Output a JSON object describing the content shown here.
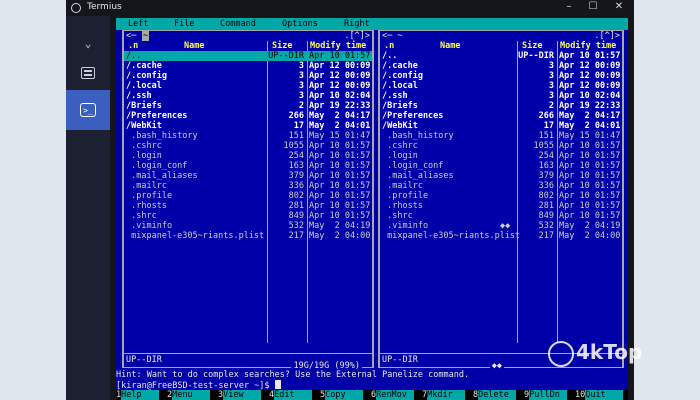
{
  "window": {
    "title": "Termius",
    "controls": [
      "–",
      "☐",
      "✕"
    ]
  },
  "sidebar": {
    "items": [
      {
        "name": "chevron-down-icon",
        "glyph": "⌄"
      },
      {
        "name": "hosts-icon"
      },
      {
        "name": "terminal-icon",
        "glyph": ">_"
      }
    ]
  },
  "menubar": {
    "items": [
      "Left",
      "File",
      "Command",
      "Options",
      "Right"
    ]
  },
  "left_panel": {
    "nav_left": "<─ ",
    "hotkey": "~",
    "nav_right": ".[^]>",
    "headers": {
      "n": ".n",
      "name": "Name",
      "size": "Size",
      "modify": "Modify time"
    },
    "rows": [
      {
        "name": "/..",
        "size": "UP--DIR",
        "date": "Apr 10 01:57",
        "type": "sel"
      },
      {
        "name": "/.cache",
        "size": "3",
        "date": "Apr 12 00:09",
        "type": "dir"
      },
      {
        "name": "/.config",
        "size": "3",
        "date": "Apr 12 00:09",
        "type": "dir"
      },
      {
        "name": "/.local",
        "size": "3",
        "date": "Apr 12 00:09",
        "type": "dir"
      },
      {
        "name": "/.ssh",
        "size": "3",
        "date": "Apr 10 02:04",
        "type": "dir"
      },
      {
        "name": "/Briefs",
        "size": "2",
        "date": "Apr 19 22:33",
        "type": "dir"
      },
      {
        "name": "/Preferences",
        "size": "266",
        "date": "May  2 04:17",
        "type": "dir"
      },
      {
        "name": "/WebKit",
        "size": "17",
        "date": "May  2 04:01",
        "type": "dir"
      },
      {
        "name": " .bash_history",
        "size": "151",
        "date": "May 15 01:47",
        "type": "file"
      },
      {
        "name": " .cshrc",
        "size": "1055",
        "date": "Apr 10 01:57",
        "type": "file"
      },
      {
        "name": " .login",
        "size": "254",
        "date": "Apr 10 01:57",
        "type": "file"
      },
      {
        "name": " .login_conf",
        "size": "163",
        "date": "Apr 10 01:57",
        "type": "file"
      },
      {
        "name": " .mail_aliases",
        "size": "379",
        "date": "Apr 10 01:57",
        "type": "file"
      },
      {
        "name": " .mailrc",
        "size": "336",
        "date": "Apr 10 01:57",
        "type": "file"
      },
      {
        "name": " .profile",
        "size": "802",
        "date": "Apr 10 01:57",
        "type": "file"
      },
      {
        "name": " .rhosts",
        "size": "281",
        "date": "Apr 10 01:57",
        "type": "file"
      },
      {
        "name": " .shrc",
        "size": "849",
        "date": "Apr 10 01:57",
        "type": "file"
      },
      {
        "name": " .viminfo",
        "size": "532",
        "date": "May  2 04:19",
        "type": "file"
      },
      {
        "name": " mixpanel-e305~riants.plist",
        "size": "217",
        "date": "May  2 04:00",
        "type": "file"
      }
    ],
    "status": "UP--DIR",
    "info": "19G/19G (99%)"
  },
  "right_panel": {
    "nav_left": "<─ ~",
    "nav_right": ".[^]>",
    "headers": {
      "n": ".n",
      "name": "Name",
      "size": "Size",
      "modify": "Modify time"
    },
    "rows": [
      {
        "name": "/..",
        "size": "UP--DIR",
        "date": "Apr 10 01:57",
        "type": "dir"
      },
      {
        "name": "/.cache",
        "size": "3",
        "date": "Apr 12 00:09",
        "type": "dir"
      },
      {
        "name": "/.config",
        "size": "3",
        "date": "Apr 12 00:09",
        "type": "dir"
      },
      {
        "name": "/.local",
        "size": "3",
        "date": "Apr 12 00:09",
        "type": "dir"
      },
      {
        "name": "/.ssh",
        "size": "3",
        "date": "Apr 10 02:04",
        "type": "dir"
      },
      {
        "name": "/Briefs",
        "size": "2",
        "date": "Apr 19 22:33",
        "type": "dir"
      },
      {
        "name": "/Preferences",
        "size": "266",
        "date": "May  2 04:17",
        "type": "dir"
      },
      {
        "name": "/WebKit",
        "size": "17",
        "date": "May  2 04:01",
        "type": "dir"
      },
      {
        "name": " .bash_history",
        "size": "151",
        "date": "May 15 01:47",
        "type": "file"
      },
      {
        "name": " .cshrc",
        "size": "1055",
        "date": "Apr 10 01:57",
        "type": "file"
      },
      {
        "name": " .login",
        "size": "254",
        "date": "Apr 10 01:57",
        "type": "file"
      },
      {
        "name": " .login_conf",
        "size": "163",
        "date": "Apr 10 01:57",
        "type": "file"
      },
      {
        "name": " .mail_aliases",
        "size": "379",
        "date": "Apr 10 01:57",
        "type": "file"
      },
      {
        "name": " .mailrc",
        "size": "336",
        "date": "Apr 10 01:57",
        "type": "file"
      },
      {
        "name": " .profile",
        "size": "802",
        "date": "Apr 10 01:57",
        "type": "file"
      },
      {
        "name": " .rhosts",
        "size": "281",
        "date": "Apr 10 01:57",
        "type": "file"
      },
      {
        "name": " .shrc",
        "size": "849",
        "date": "Apr 10 01:57",
        "type": "file"
      },
      {
        "name": " .viminfo",
        "size": "532",
        "date": "May  2 04:19",
        "type": "file",
        "mark": "◆◆"
      },
      {
        "name": " mixpanel-e305~riants.plist",
        "size": "217",
        "date": "May  2 04:00",
        "type": "file"
      }
    ],
    "status": "UP--DIR",
    "info": "◆◆"
  },
  "hint": "Hint: Want to do complex searches? Use the External Panelize command.",
  "prompt": "[kiran@FreeBSD-test-server ~]$",
  "fkeys": [
    {
      "num": "1",
      "label": "Help"
    },
    {
      "num": "2",
      "label": "Menu"
    },
    {
      "num": "3",
      "label": "View"
    },
    {
      "num": "4",
      "label": "Edit"
    },
    {
      "num": "5",
      "label": "Copy"
    },
    {
      "num": "6",
      "label": "RenMov"
    },
    {
      "num": "7",
      "label": "Mkdir"
    },
    {
      "num": "8",
      "label": "Delete"
    },
    {
      "num": "9",
      "label": "PullDn"
    },
    {
      "num": "10",
      "label": "Quit"
    }
  ],
  "watermark": {
    "text": "4kTop"
  },
  "colors": {
    "terminal_bg": "#0000a8",
    "cyan": "#00a8a8",
    "yellow": "#ffff55",
    "sidebar_active": "#3b5fbf"
  }
}
